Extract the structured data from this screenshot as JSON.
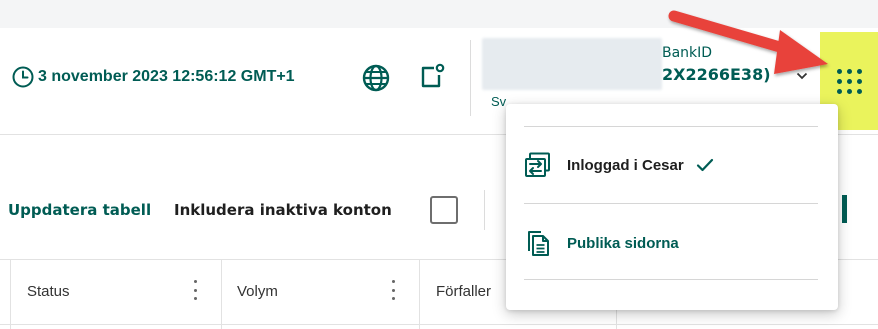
{
  "header": {
    "datetime": "3 november 2023 12:56:12 GMT+1",
    "user": {
      "auth_method": "BankID",
      "id": "2X2266E38)",
      "org": "Sv"
    }
  },
  "toolbar": {
    "refresh_label": "Uppdatera tabell",
    "include_inactive_label": "Inkludera inaktiva konton"
  },
  "table": {
    "columns": [
      {
        "label": "Status"
      },
      {
        "label": "Volym"
      },
      {
        "label": "Förfaller"
      }
    ]
  },
  "menu": {
    "items": [
      {
        "label": "Inloggad i Cesar",
        "checked": true,
        "icon": "switch-arrows-icon"
      },
      {
        "label": "Publika sidorna",
        "checked": false,
        "icon": "documents-icon"
      }
    ]
  },
  "colors": {
    "brand_teal": "#005c54",
    "highlight_yellow": "#eaf35c",
    "annotation_red": "#e8423a"
  }
}
